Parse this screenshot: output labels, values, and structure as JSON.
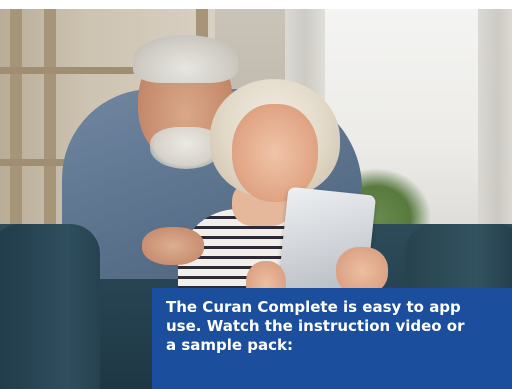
{
  "caption": {
    "line1": "The Curan Complete is easy to app",
    "line2": "use. Watch the instruction video or",
    "line3": "a sample pack:"
  },
  "colors": {
    "caption_background": "#1b4f9e",
    "caption_text": "#ffffff"
  }
}
